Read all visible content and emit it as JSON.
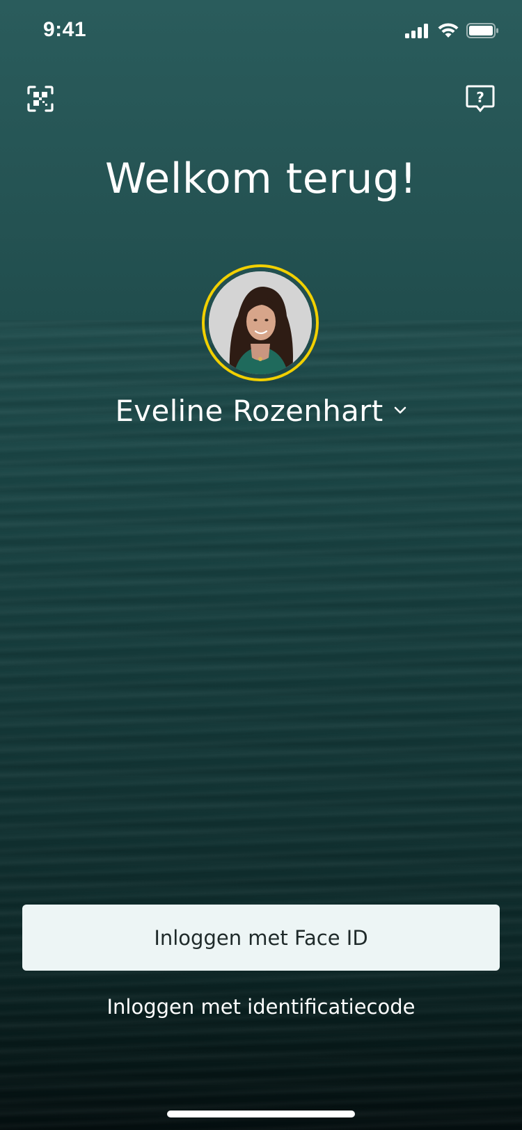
{
  "status_bar": {
    "time": "9:41",
    "icons": [
      "cellular-signal-icon",
      "wifi-icon",
      "battery-icon"
    ]
  },
  "header": {
    "left_icon": "qr-scan-icon",
    "right_icon": "help-chat-icon"
  },
  "welcome": {
    "title": "Welkom terug!"
  },
  "user": {
    "name": "Eveline Rozenhart",
    "dropdown_icon": "chevron-down-icon"
  },
  "actions": {
    "face_id_label": "Inloggen met Face ID",
    "code_label": "Inloggen met identificatiecode"
  },
  "colors": {
    "avatar_ring": "#f2d000",
    "button_background": "#edf5f5",
    "background_top": "#2a5c5c",
    "background_bottom": "#050f10"
  }
}
